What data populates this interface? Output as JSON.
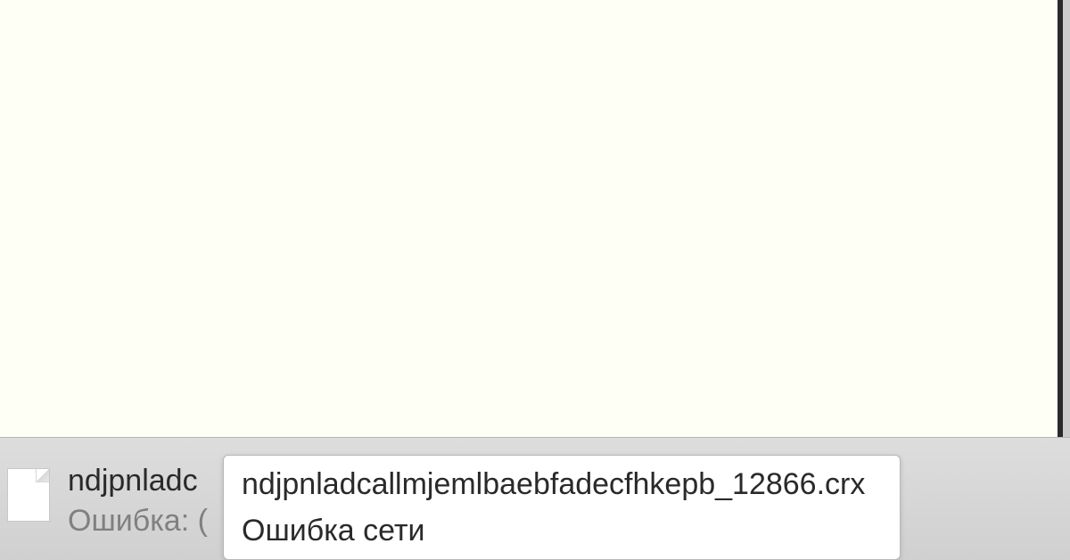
{
  "download": {
    "filename_truncated": "ndjpnladc",
    "status_label": "Ошибка: (",
    "tooltip_filename": "ndjpnladcallmjemlbaebfadecfhkepb_12866.crx",
    "tooltip_error": "Ошибка сети"
  }
}
